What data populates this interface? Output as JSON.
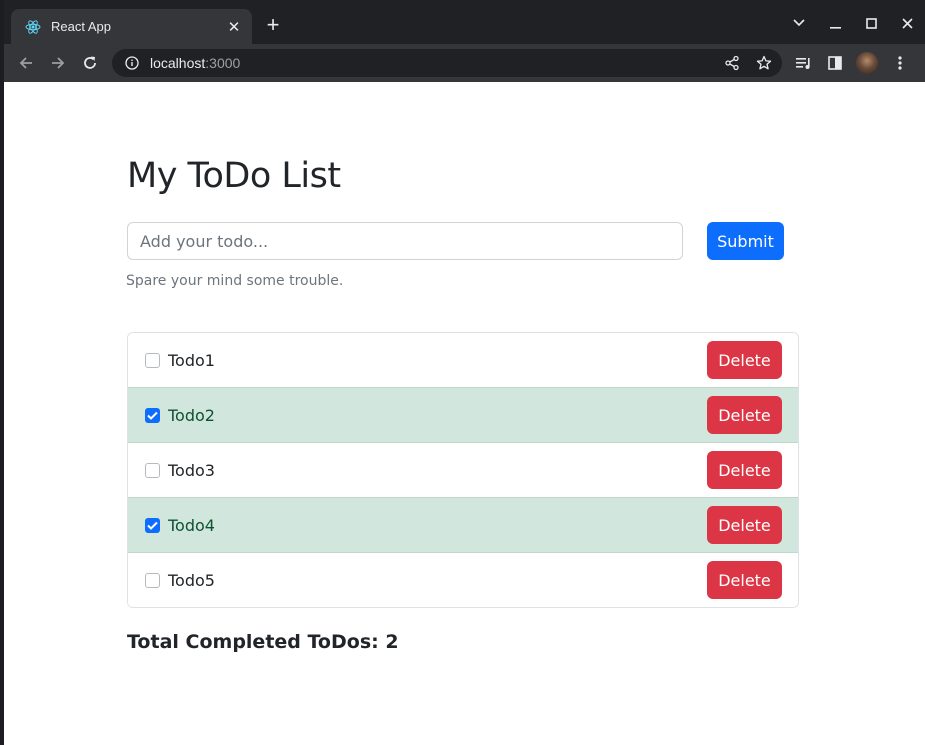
{
  "browser": {
    "tab_title": "React App",
    "url_host": "localhost",
    "url_port": ":3000"
  },
  "page": {
    "title": "My ToDo List",
    "input_placeholder": "Add your todo...",
    "submit_label": "Submit",
    "help_text": "Spare your mind some trouble.",
    "todos": [
      {
        "label": "Todo1",
        "completed": false,
        "delete_label": "Delete"
      },
      {
        "label": "Todo2",
        "completed": true,
        "delete_label": "Delete"
      },
      {
        "label": "Todo3",
        "completed": false,
        "delete_label": "Delete"
      },
      {
        "label": "Todo4",
        "completed": true,
        "delete_label": "Delete"
      },
      {
        "label": "Todo5",
        "completed": false,
        "delete_label": "Delete"
      }
    ],
    "total_text": "Total Completed ToDos: 2"
  },
  "colors": {
    "primary": "#0d6efd",
    "danger": "#dc3545",
    "completed_row": "#d1e7dd",
    "completed_text": "#0f5132"
  }
}
